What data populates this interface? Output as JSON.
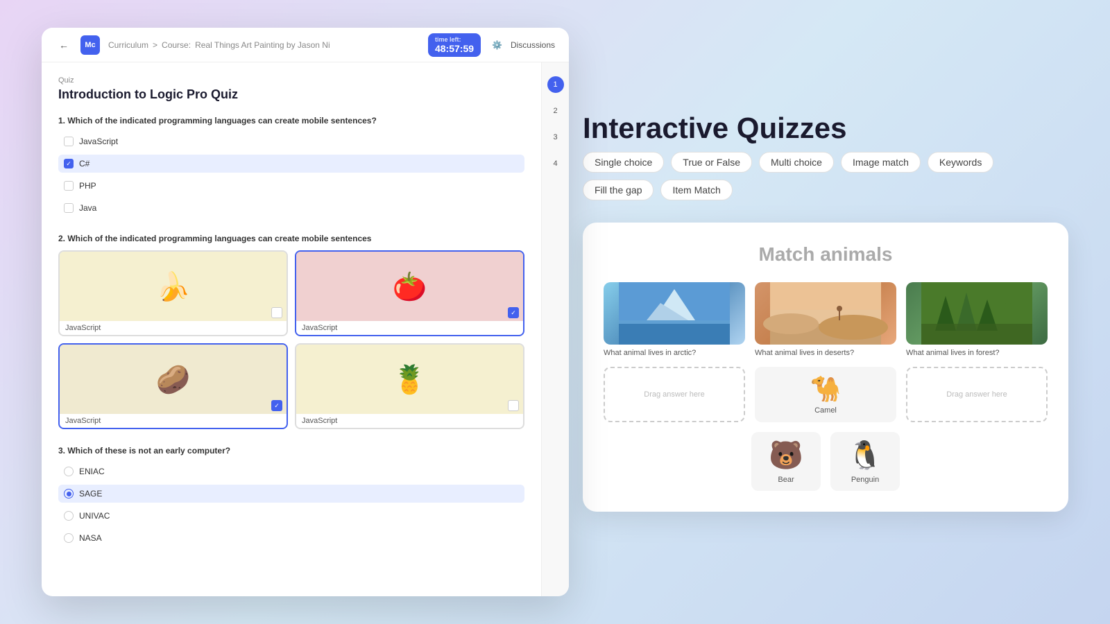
{
  "header": {
    "back_label": "←",
    "logo_text": "Mc",
    "nav_curriculum": "Curriculum",
    "nav_separator": ">",
    "course_label": "Course:",
    "course_title": "Real Things Art Painting by Jason Ni",
    "timer_label": "time left:",
    "timer_value": "48:57:59",
    "discussions_label": "Discussions"
  },
  "quiz": {
    "label": "Quiz",
    "title": "Introduction to Logic Pro Quiz",
    "questions": [
      {
        "number": "1.",
        "text": "Which of the indicated programming languages can create mobile sentences?",
        "type": "checkbox",
        "options": [
          {
            "label": "JavaScript",
            "checked": false
          },
          {
            "label": "C#",
            "checked": true
          },
          {
            "label": "PHP",
            "checked": false
          },
          {
            "label": "Java",
            "checked": false
          }
        ]
      },
      {
        "number": "2.",
        "text": "Which of the indicated programming languages can create mobile sentences",
        "type": "image",
        "options": [
          {
            "label": "JavaScript",
            "emoji": "🍌",
            "bg": "banana-bg",
            "checked": false
          },
          {
            "label": "JavaScript",
            "emoji": "🍅",
            "bg": "tomato-bg",
            "checked": true
          },
          {
            "label": "JavaScript",
            "emoji": "🥔",
            "bg": "potato-bg",
            "checked": true
          },
          {
            "label": "JavaScript",
            "emoji": "🍍",
            "bg": "pineapple-bg",
            "checked": false
          }
        ]
      },
      {
        "number": "3.",
        "text": "Which of these is not an early computer?",
        "type": "radio",
        "options": [
          {
            "label": "ENIAC",
            "checked": false
          },
          {
            "label": "SAGE",
            "checked": true
          },
          {
            "label": "UNIVAC",
            "checked": false
          },
          {
            "label": "NASA",
            "checked": false
          }
        ]
      }
    ],
    "sidebar_numbers": [
      "1",
      "2",
      "3",
      "4"
    ]
  },
  "right": {
    "title": "Interactive Quizzes",
    "tags": [
      "Single choice",
      "True or False",
      "Multi choice",
      "Image match",
      "Keywords",
      "Fill the gap",
      "Item Match"
    ]
  },
  "match_panel": {
    "title": "Match animals",
    "items": [
      {
        "question": "What animal lives in arctic?",
        "type": "arctic"
      },
      {
        "question": "What animal lives in deserts?",
        "type": "desert"
      },
      {
        "question": "What animal lives in forest?",
        "type": "forest"
      }
    ],
    "drop_zones": [
      {
        "text": "Drag answer here",
        "filled": false
      },
      {
        "text": "",
        "filled": true,
        "animal": "🐪",
        "label": "Camel"
      },
      {
        "text": "Drag answer here",
        "filled": false
      }
    ],
    "answers": [
      {
        "animal": "🐻",
        "label": "Bear"
      },
      {
        "animal": "🐧",
        "label": "Penguin"
      }
    ]
  }
}
